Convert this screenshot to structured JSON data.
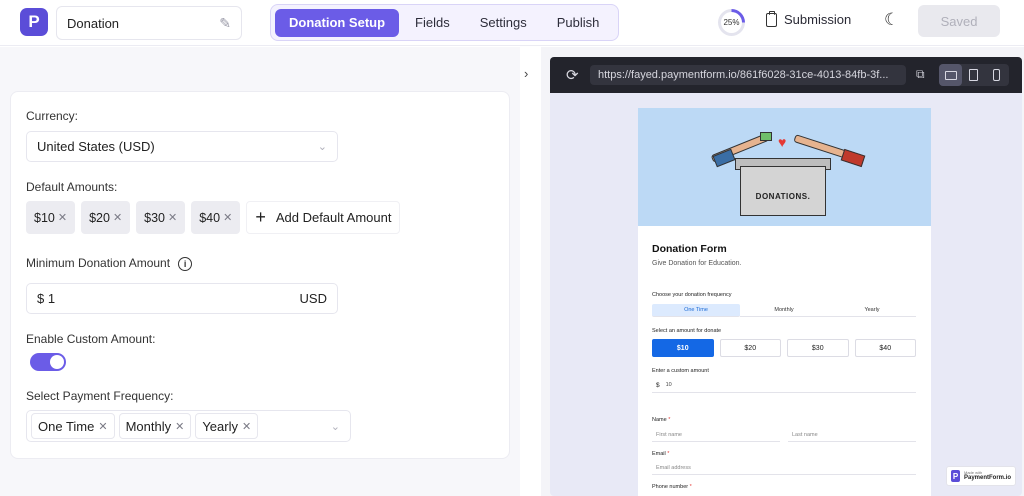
{
  "header": {
    "logo_letter": "P",
    "form_name": "Donation",
    "tabs": [
      {
        "label": "Donation Setup",
        "active": true
      },
      {
        "label": "Fields",
        "active": false
      },
      {
        "label": "Settings",
        "active": false
      },
      {
        "label": "Publish",
        "active": false
      }
    ],
    "progress_label": "25%",
    "progress_value": 25,
    "submission_label": "Submission",
    "saved_label": "Saved"
  },
  "settings": {
    "currency_label": "Currency:",
    "currency_value": "United States (USD)",
    "default_amounts_label": "Default Amounts:",
    "default_amounts": [
      "$10",
      "$20",
      "$30",
      "$40"
    ],
    "add_default_amount": "Add Default Amount",
    "minimum_label": "Minimum Donation Amount",
    "minimum_prefix": "$",
    "minimum_value": "1",
    "minimum_currency": "USD",
    "custom_amount_label": "Enable Custom Amount:",
    "custom_amount_enabled": true,
    "frequency_label": "Select Payment Frequency:",
    "frequencies": [
      "One Time",
      "Monthly",
      "Yearly"
    ]
  },
  "preview": {
    "url": "https://fayed.paymentform.io/861f6028-31ce-4013-84fb-3f...",
    "devices": [
      "desktop",
      "tablet",
      "mobile"
    ],
    "active_device": "desktop",
    "hero_text": "DONATIONS.",
    "form_title": "Donation Form",
    "form_subtitle": "Give Donation for Education.",
    "frequency_question": "Choose your donation frequency",
    "frequency_options": [
      "One Time",
      "Monthly",
      "Yearly"
    ],
    "amount_question": "Select an amount for donate",
    "amount_options": [
      "$10",
      "$20",
      "$30",
      "$40"
    ],
    "custom_label": "Enter a custom amount",
    "custom_prefix": "$",
    "custom_value": "10",
    "name_label": "Name",
    "required_mark": "*",
    "first_name_placeholder": "First name",
    "last_name_placeholder": "Last name",
    "email_label": "Email",
    "email_placeholder": "Email address",
    "phone_label": "Phone number",
    "made_with_small": "Made with",
    "made_with_brand": "PaymentForm.io"
  },
  "colors": {
    "accent": "#6b5ce7",
    "primary_blue": "#1468e5",
    "hero_bg": "#bcd9f5"
  }
}
